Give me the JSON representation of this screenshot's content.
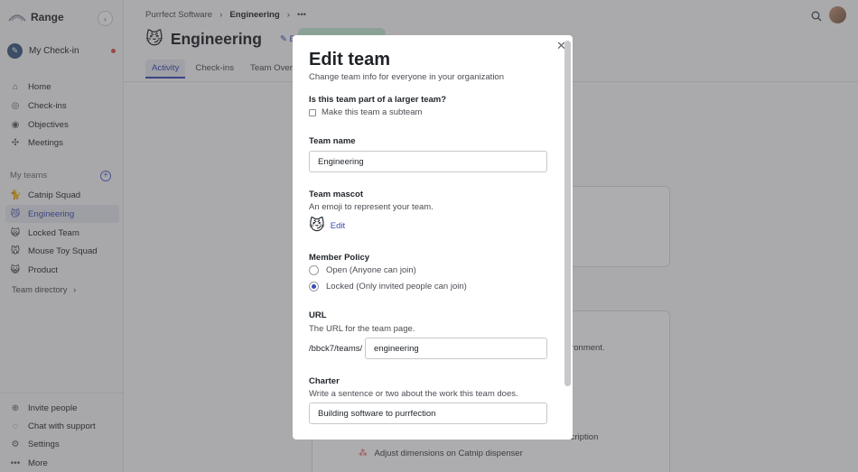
{
  "app": {
    "name": "Range"
  },
  "sidebar": {
    "checkin_label": "My Check-in",
    "nav": [
      {
        "label": "Home",
        "icon": "home-icon"
      },
      {
        "label": "Check-ins",
        "icon": "check-circle-icon"
      },
      {
        "label": "Objectives",
        "icon": "target-icon"
      },
      {
        "label": "Meetings",
        "icon": "meetings-icon"
      }
    ],
    "teams_label": "My teams",
    "teams": [
      {
        "label": "Catnip Squad",
        "emoji": "🐈"
      },
      {
        "label": "Engineering",
        "emoji": "😼",
        "active": true
      },
      {
        "label": "Locked Team",
        "emoji": "🙀"
      },
      {
        "label": "Mouse Toy Squad",
        "emoji": "🐭"
      },
      {
        "label": "Product",
        "emoji": "😺"
      }
    ],
    "directory_label": "Team directory",
    "bottom": [
      {
        "label": "Invite people",
        "icon": "plus-circle-icon"
      },
      {
        "label": "Chat with support",
        "icon": "chat-icon"
      },
      {
        "label": "Settings",
        "icon": "gear-icon"
      },
      {
        "label": "More",
        "icon": "more-icon"
      }
    ]
  },
  "header": {
    "breadcrumb": [
      "Purrfect Software",
      "Engineering"
    ],
    "team_emoji": "😼",
    "team_title": "Engineering",
    "edit_label": "Edit",
    "tabs": [
      "Activity",
      "Check-ins",
      "Team Overv"
    ]
  },
  "background": {
    "line1": "ironment.",
    "line2": "scription",
    "line3": "Adjust dimensions on Catnip dispenser"
  },
  "modal": {
    "title": "Edit team",
    "subtitle": "Change team info for everyone in your organization",
    "subteam_question": "Is this team part of a larger team?",
    "subteam_checkbox": "Make this team a subteam",
    "name_label": "Team name",
    "name_value": "Engineering",
    "mascot_label": "Team mascot",
    "mascot_hint": "An emoji to represent your team.",
    "mascot_emoji": "😼",
    "mascot_edit": "Edit",
    "policy_label": "Member Policy",
    "policy_open": "Open (Anyone can join)",
    "policy_locked": "Locked (Only invited people can join)",
    "url_label": "URL",
    "url_hint": "The URL for the team page.",
    "url_prefix": "/bbck7/teams/",
    "url_value": "engineering",
    "charter_label": "Charter",
    "charter_hint": "Write a sentence or two about the work this team does.",
    "charter_value": "Building software to purrfection"
  }
}
